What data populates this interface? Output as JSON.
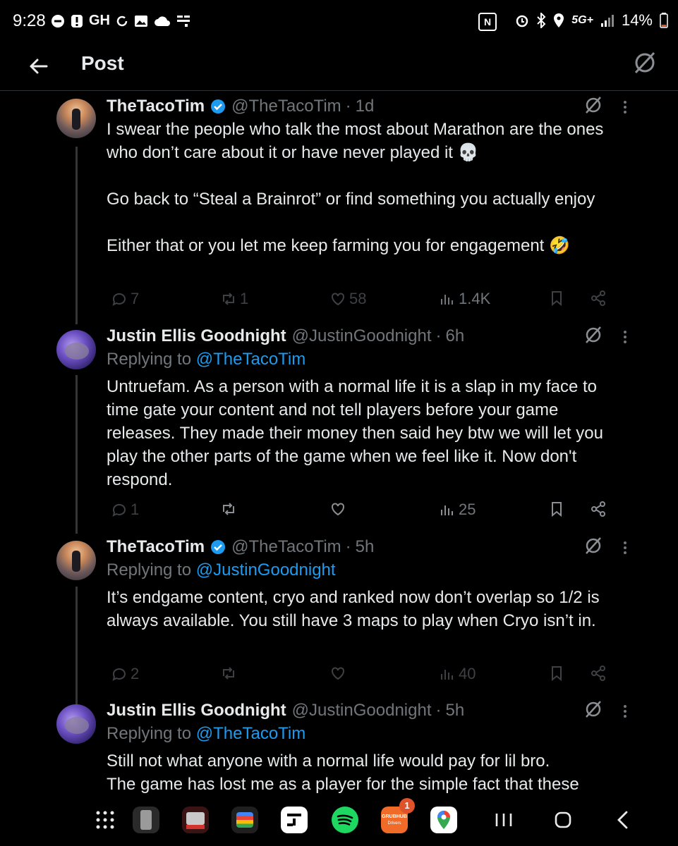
{
  "status_bar": {
    "time": "9:28",
    "left_icons": [
      "do-not-disturb-icon",
      "alert-icon",
      "GH",
      "sync-icon",
      "gallery-icon",
      "cloud-icon",
      "notification-icon"
    ],
    "carrier_text": "GH",
    "network": "5G+",
    "battery": "14%"
  },
  "header": {
    "title": "Post"
  },
  "tweets": [
    {
      "name": "TheTacoTim",
      "verified": true,
      "handle": "@TheTacoTim",
      "time": "1d",
      "replying_prefix": "",
      "replying_to": "",
      "text": "I swear the people who talk the most about Marathon are the ones who don’t care about it or have never played it 💀\n\nGo back to “Steal a Brainrot” or find something you actually enjoy\n\nEither that or you let me keep farming you for engagement 🤣",
      "replies": "7",
      "reposts": "1",
      "likes": "58",
      "views": "1.4K"
    },
    {
      "name": "Justin Ellis Goodnight",
      "verified": false,
      "handle": "@JustinGoodnight",
      "time": "6h",
      "replying_prefix": "Replying to ",
      "replying_to": "@TheTacoTim",
      "text": "Untruefam. As a person with a normal life it is a slap in my face to time gate your content and not tell players before your game releases. They made their money then said hey btw we will let you play the other parts of the game when we feel like it. Now don't respond.",
      "replies": "1",
      "reposts": "",
      "likes": "",
      "views": "25"
    },
    {
      "name": "TheTacoTim",
      "verified": true,
      "handle": "@TheTacoTim",
      "time": "5h",
      "replying_prefix": "Replying to ",
      "replying_to": "@JustinGoodnight",
      "text": "It’s endgame content, cryo and ranked now don’t overlap so 1/2 is always available. You still have 3 maps to play when Cryo isn’t in.",
      "replies": "2",
      "reposts": "",
      "likes": "",
      "views": "40"
    },
    {
      "name": "Justin Ellis Goodnight",
      "verified": false,
      "handle": "@JustinGoodnight",
      "time": "5h",
      "replying_prefix": "Replying to ",
      "replying_to": "@TheTacoTim",
      "text": "Still not what anyone with a normal life would pay for lil bro.\nThe game has lost me as a player for the simple fact that these",
      "replies": "",
      "reposts": "",
      "likes": "",
      "views": ""
    }
  ],
  "nav_bar": {
    "apps": [
      "app-drawer-icon",
      "phone-app-icon",
      "reader-app-icon",
      "wallet-app-icon",
      "teams-app-icon",
      "spotify-app-icon",
      "grubhub-drivers-app-icon",
      "maps-app-icon"
    ],
    "grubhub_label": "GRUBHUB",
    "grubhub_sub": "Drivers",
    "grubhub_badge": "1",
    "buttons": [
      "recents-button",
      "home-button",
      "back-button"
    ]
  },
  "colors": {
    "background": "#000000",
    "text": "#e7e9ea",
    "muted": "#71767b",
    "accent": "#1d9bf0",
    "divider": "#2f3336"
  }
}
